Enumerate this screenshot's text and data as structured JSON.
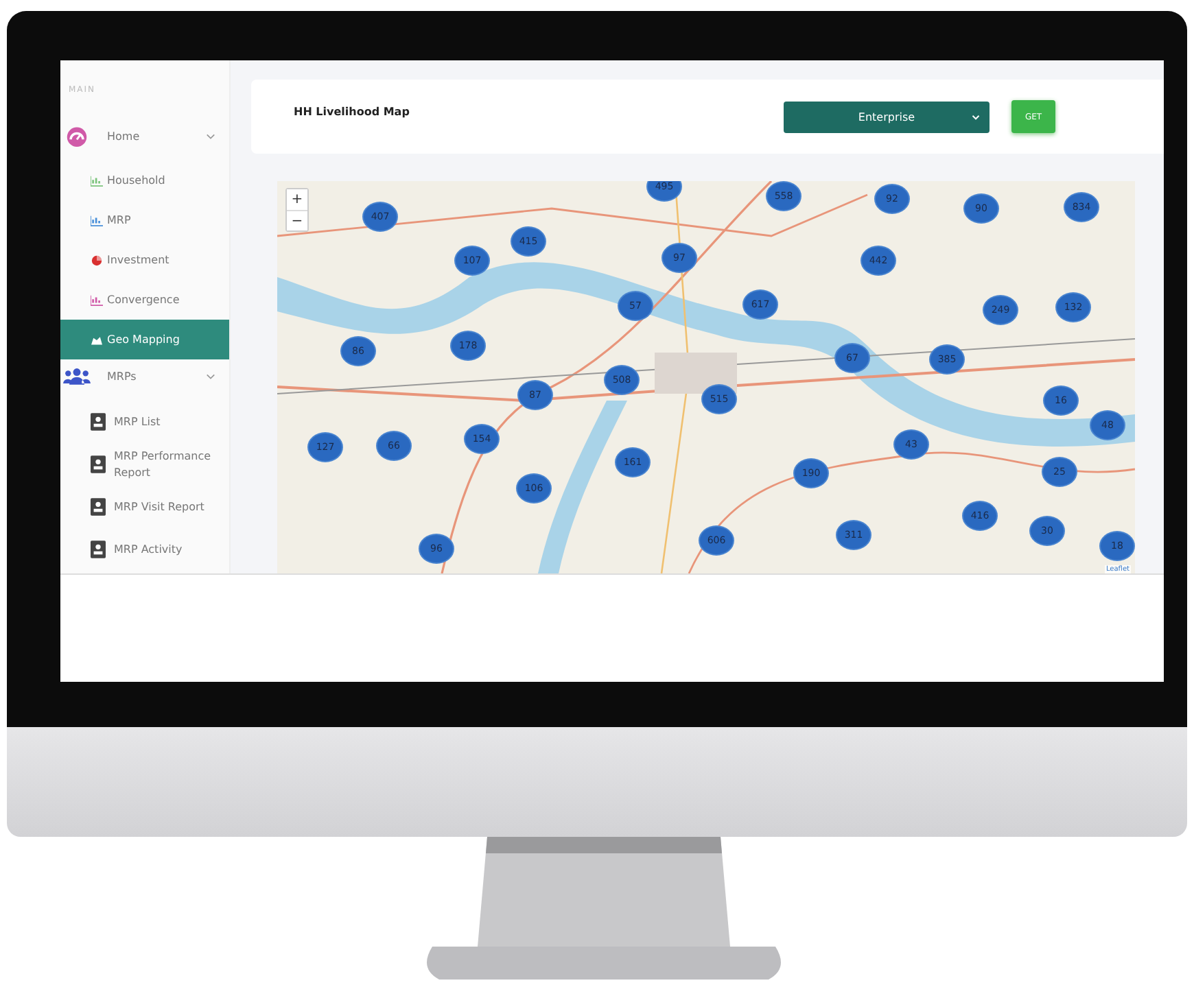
{
  "sidebar": {
    "section_label": "MAIN",
    "groups": [
      {
        "label": "Home",
        "expanded": true,
        "children": [
          {
            "label": "Household",
            "selected": false
          },
          {
            "label": "MRP",
            "selected": false
          },
          {
            "label": "Investment",
            "selected": false
          },
          {
            "label": "Convergence",
            "selected": false
          },
          {
            "label": "Geo Mapping",
            "selected": true
          }
        ]
      },
      {
        "label": "MRPs",
        "expanded": true,
        "children": [
          {
            "label": "MRP List",
            "selected": false
          },
          {
            "label": "MRP Performance Report",
            "selected": false
          },
          {
            "label": "MRP Visit Report",
            "selected": false
          },
          {
            "label": "MRP Activity",
            "selected": false
          }
        ]
      }
    ]
  },
  "header": {
    "title": "HH Livelihood Map",
    "select": {
      "value": "Enterprise"
    },
    "button": "GET"
  },
  "map": {
    "zoom_in": "+",
    "zoom_out": "−",
    "attribution": "Leaflet",
    "markers": [
      "495",
      "558",
      "92",
      "90",
      "834",
      "407",
      "415",
      "107",
      "97",
      "442",
      "57",
      "617",
      "249",
      "132",
      "86",
      "178",
      "67",
      "385",
      "508",
      "87",
      "515",
      "16",
      "48",
      "127",
      "66",
      "154",
      "43",
      "161",
      "190",
      "25",
      "106",
      "416",
      "30",
      "311",
      "606",
      "96",
      "18"
    ]
  }
}
